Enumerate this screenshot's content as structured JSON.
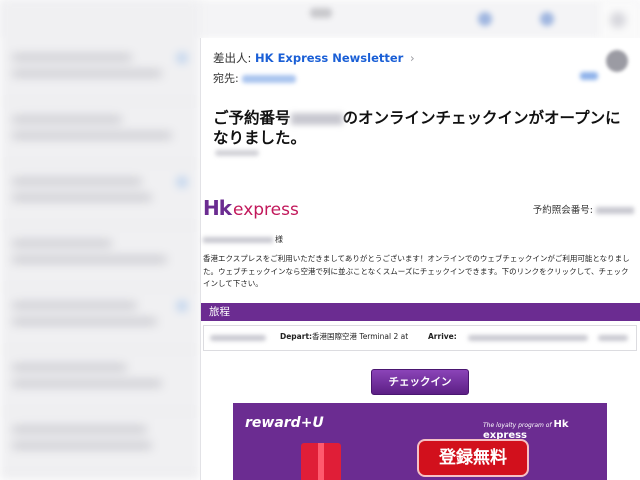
{
  "header": {
    "sender_label": "差出人:",
    "sender_name": "HK Express Newsletter",
    "sender_chevron": "›",
    "to_label": "宛先:"
  },
  "subject": {
    "before": "ご予約番号",
    "after": "のオンラインチェックインがオープンになりました。"
  },
  "body": {
    "logo_hk": "Hk",
    "logo_express": "express",
    "ref_label": "予約照会番号:",
    "greeting_suffix": "様",
    "paragraph": "香港エクスプレスをご利用いただきましてありがとうございます！オンラインでのウェブチェックインがご利用可能となりました。ウェブチェックインなら空港で列に並ぶことなくスムーズにチェックインできます。下のリンクをクリックして、チェックインして下さい。",
    "itinerary_title": "旅程",
    "depart_label": "Depart:",
    "depart_value": "香港国際空港 Terminal 2 at",
    "arrive_label": "Arrive:",
    "checkin_button": "チェックイン"
  },
  "banner": {
    "reward": "reward+U",
    "tagline": "The loyalty program of",
    "tagline_brand": "Hk express",
    "signup": "登録無料"
  },
  "colors": {
    "brand_purple": "#6b2c91",
    "brand_pink": "#c2185b",
    "link_blue": "#1a5fd6",
    "signup_red": "#d2101c"
  }
}
